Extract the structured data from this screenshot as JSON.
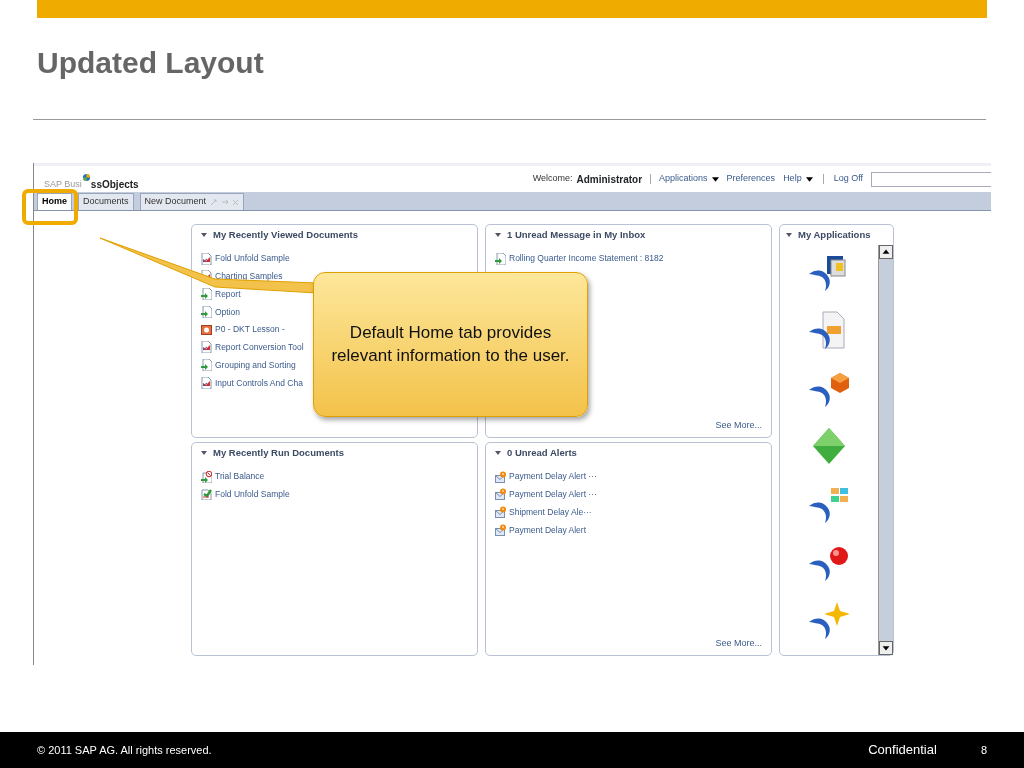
{
  "slide": {
    "title": "Updated Layout",
    "callout": "Default Home tab provides relevant information to the user.",
    "footer": {
      "copyright": "© 2011 SAP AG. All rights reserved.",
      "classification": "Confidential",
      "page": "8"
    }
  },
  "app": {
    "logo": {
      "faded": "SAP Busi",
      "bold": "ssObjects"
    },
    "header": {
      "welcome": "Welcome:",
      "user": "Administrator",
      "menu": [
        {
          "label": "Applications",
          "kind": "dropdown"
        },
        {
          "label": "Preferences",
          "kind": "link"
        },
        {
          "label": "Help",
          "kind": "dropdown"
        },
        {
          "label": "Log Off",
          "kind": "link"
        }
      ]
    },
    "tabs": [
      {
        "label": "Home",
        "selected": true
      },
      {
        "label": "Documents",
        "selected": false
      },
      {
        "label": "New Document",
        "selected": false
      }
    ],
    "panels": [
      {
        "title": "My Recently Viewed Documents",
        "items": [
          {
            "label": "Fold Unfold Sample",
            "kind": "webi"
          },
          {
            "label": "Charting Samples",
            "kind": "webi"
          },
          {
            "label": "Report",
            "kind": "crystal"
          },
          {
            "label": "Option",
            "kind": "crystal"
          },
          {
            "label": "P0 - DKT Lesson -",
            "kind": "slides"
          },
          {
            "label": "Report Conversion Tool",
            "kind": "webi"
          },
          {
            "label": "Grouping and Sorting",
            "kind": "crystal"
          },
          {
            "label": "Input Controls And Cha",
            "kind": "webi"
          }
        ]
      },
      {
        "title": "1 Unread Message in My Inbox",
        "items": [
          {
            "label": "Rolling Quarter Income Statement : 8182",
            "kind": "crystal"
          }
        ],
        "see_more": "See More..."
      },
      {
        "title": "My Recently Run Documents",
        "items": [
          {
            "label": "Trial Balance",
            "kind": "failed"
          },
          {
            "label": "Fold Unfold Sample",
            "kind": "success"
          }
        ]
      },
      {
        "title": "0 Unread Alerts",
        "items": [
          {
            "label": "Payment Delay Alert ···",
            "kind": "alert"
          },
          {
            "label": "Payment Delay Alert ···",
            "kind": "alert"
          },
          {
            "label": "Shipment Delay Ale···",
            "kind": "alert"
          },
          {
            "label": "Payment Delay Alert",
            "kind": "alert"
          }
        ],
        "see_more": "See More..."
      }
    ],
    "applications": {
      "title": "My Applications"
    }
  }
}
